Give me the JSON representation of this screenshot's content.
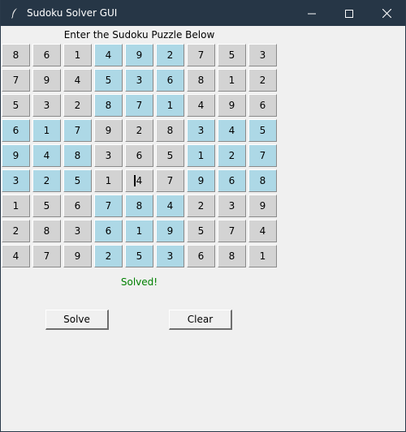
{
  "window": {
    "title": "Sudoku Solver GUI",
    "icons": [
      "feather-icon",
      "minimize-icon",
      "maximize-icon",
      "close-icon"
    ]
  },
  "heading": "Enter the Sudoku Puzzle Below",
  "grid": {
    "rows": [
      [
        "8",
        "6",
        "1",
        "4",
        "9",
        "2",
        "7",
        "5",
        "3"
      ],
      [
        "7",
        "9",
        "4",
        "5",
        "3",
        "6",
        "8",
        "1",
        "2"
      ],
      [
        "5",
        "3",
        "2",
        "8",
        "7",
        "1",
        "4",
        "9",
        "6"
      ],
      [
        "6",
        "1",
        "7",
        "9",
        "2",
        "8",
        "3",
        "4",
        "5"
      ],
      [
        "9",
        "4",
        "8",
        "3",
        "6",
        "5",
        "1",
        "2",
        "7"
      ],
      [
        "3",
        "2",
        "5",
        "1",
        "4",
        "7",
        "9",
        "6",
        "8"
      ],
      [
        "1",
        "5",
        "6",
        "7",
        "8",
        "4",
        "2",
        "3",
        "9"
      ],
      [
        "2",
        "8",
        "3",
        "6",
        "1",
        "9",
        "5",
        "7",
        "4"
      ],
      [
        "4",
        "7",
        "9",
        "2",
        "5",
        "3",
        "6",
        "8",
        "1"
      ]
    ],
    "focused_cell": [
      5,
      4
    ]
  },
  "status": {
    "text": "Solved!",
    "color": "#008000"
  },
  "buttons": {
    "solve": "Solve",
    "clear": "Clear"
  },
  "colors": {
    "titlebar": "#263646",
    "cell_gray": "#d3d3d3",
    "cell_blue": "#add8e6",
    "background": "#f0f0f0"
  }
}
